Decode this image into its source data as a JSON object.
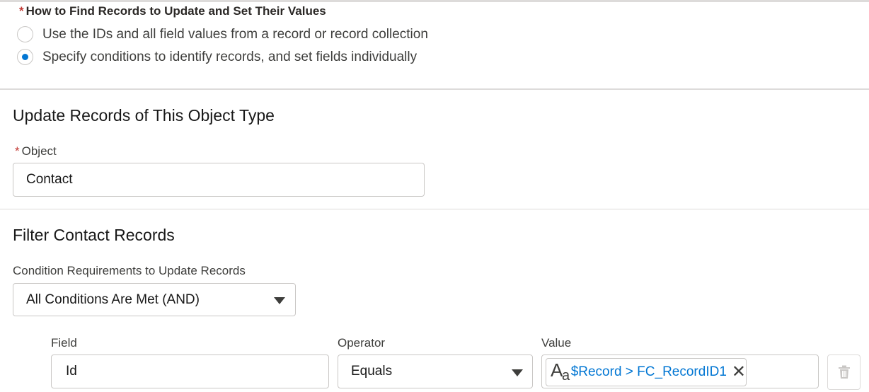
{
  "find_section": {
    "required_marker": "*",
    "label": "How to Find Records to Update and Set Their Values",
    "options": [
      {
        "label": "Use the IDs and all field values from a record or record collection",
        "selected": false
      },
      {
        "label": "Specify conditions to identify records, and set fields individually",
        "selected": true
      }
    ]
  },
  "object_section": {
    "title": "Update Records of This Object Type",
    "object_label": "Object",
    "required_marker": "*",
    "object_value": "Contact"
  },
  "filter_section": {
    "title": "Filter Contact Records",
    "condition_label": "Condition Requirements to Update Records",
    "condition_value": "All Conditions Are Met (AND)",
    "columns": {
      "field": "Field",
      "operator": "Operator",
      "value": "Value"
    },
    "row": {
      "field": "Id",
      "operator": "Equals",
      "value": "$Record > FC_RecordID1",
      "value_icon": "text-type-icon"
    }
  },
  "colors": {
    "accent": "#0176d3",
    "required": "#c23934",
    "border": "#c9c7c5",
    "divider": "#dddbda"
  }
}
